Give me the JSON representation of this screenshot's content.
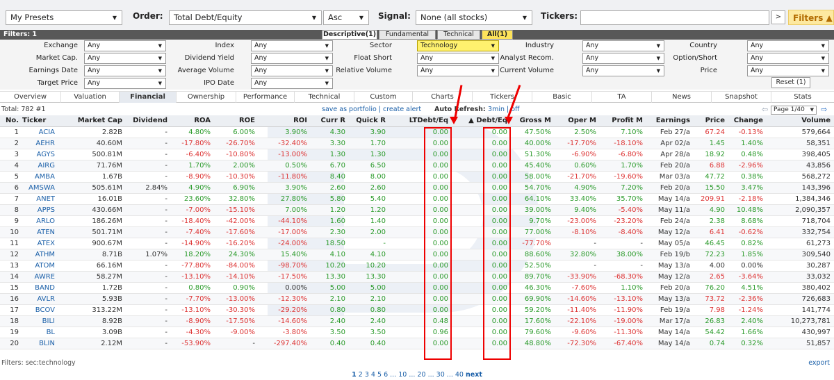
{
  "toolbar": {
    "preset": "My Presets",
    "order_label": "Order:",
    "order_value": "Total Debt/Equity",
    "direction": "Asc",
    "signal_label": "Signal:",
    "signal_value": "None (all stocks)",
    "tickers_label": "Tickers:",
    "tickers_value": "",
    "go_label": ">",
    "filters_label": "Filters ▲"
  },
  "filters_header": "Filters: 1",
  "filter_tabs": [
    "Descriptive(1)",
    "Fundamental",
    "Technical",
    "All(1)"
  ],
  "filter_rows": [
    [
      [
        "Exchange",
        "Any"
      ],
      [
        "Index",
        "Any"
      ],
      [
        "Sector",
        "Technology"
      ],
      [
        "Industry",
        "Any"
      ],
      [
        "Country",
        "Any"
      ]
    ],
    [
      [
        "Market Cap.",
        "Any"
      ],
      [
        "Dividend Yield",
        "Any"
      ],
      [
        "Float Short",
        "Any"
      ],
      [
        "Analyst Recom.",
        "Any"
      ],
      [
        "Option/Short",
        "Any"
      ]
    ],
    [
      [
        "Earnings Date",
        "Any"
      ],
      [
        "Average Volume",
        "Any"
      ],
      [
        "Relative Volume",
        "Any"
      ],
      [
        "Current Volume",
        "Any"
      ],
      [
        "Price",
        "Any"
      ]
    ],
    [
      [
        "Target Price",
        "Any"
      ],
      [
        "IPO Date",
        "Any"
      ]
    ]
  ],
  "reset_label": "Reset (1)",
  "view_tabs": [
    "Overview",
    "Valuation",
    "Financial",
    "Ownership",
    "Performance",
    "Technical",
    "Custom",
    "Charts",
    "Tickers",
    "Basic",
    "TA",
    "News",
    "Snapshot",
    "Stats"
  ],
  "total": "Total: 782 #1",
  "save_links": "save as portfolio | create alert",
  "auto_refresh_label": "Auto Refresh:",
  "auto_refresh_value": "3min | off",
  "page_select": "Page 1/40",
  "columns": [
    "No.",
    "Ticker",
    "Market Cap",
    "Dividend",
    "ROA",
    "ROE",
    "ROI",
    "Curr R",
    "Quick R",
    "LTDebt/Eq",
    "▲ Debt/Eq",
    "Gross M",
    "Oper M",
    "Profit M",
    "Earnings",
    "Price",
    "Change",
    "Volume"
  ],
  "rows": [
    [
      "1",
      "ACIA",
      "2.82B",
      "-",
      "4.80%",
      "6.00%",
      "3.90%",
      "4.30",
      "3.90",
      "0.00",
      "0.00",
      "47.50%",
      "2.50%",
      "7.10%",
      "Feb 27/a",
      "67.24",
      "-0.13%",
      "579,664"
    ],
    [
      "2",
      "AEHR",
      "40.60M",
      "-",
      "-17.80%",
      "-26.70%",
      "-32.40%",
      "3.30",
      "1.70",
      "0.00",
      "0.00",
      "40.00%",
      "-17.70%",
      "-18.10%",
      "Apr 02/a",
      "1.45",
      "1.40%",
      "58,351"
    ],
    [
      "3",
      "AGYS",
      "500.81M",
      "-",
      "-6.40%",
      "-10.80%",
      "-13.00%",
      "1.30",
      "1.30",
      "0.00",
      "0.00",
      "51.30%",
      "-6.90%",
      "-6.80%",
      "Apr 28/a",
      "18.92",
      "0.48%",
      "398,405"
    ],
    [
      "4",
      "AIRG",
      "71.76M",
      "-",
      "1.70%",
      "2.00%",
      "0.50%",
      "6.70",
      "6.50",
      "0.00",
      "0.00",
      "45.40%",
      "0.60%",
      "1.70%",
      "Feb 20/a",
      "6.88",
      "-2.96%",
      "43,856"
    ],
    [
      "5",
      "AMBA",
      "1.67B",
      "-",
      "-8.90%",
      "-10.30%",
      "-11.80%",
      "8.40",
      "8.00",
      "0.00",
      "0.00",
      "58.00%",
      "-21.70%",
      "-19.60%",
      "Mar 03/a",
      "47.72",
      "0.38%",
      "568,272"
    ],
    [
      "6",
      "AMSWA",
      "505.61M",
      "2.84%",
      "4.90%",
      "6.90%",
      "3.90%",
      "2.60",
      "2.60",
      "0.00",
      "0.00",
      "54.70%",
      "4.90%",
      "7.20%",
      "Feb 20/a",
      "15.50",
      "3.47%",
      "143,396"
    ],
    [
      "7",
      "ANET",
      "16.01B",
      "-",
      "23.60%",
      "32.80%",
      "27.80%",
      "5.80",
      "5.40",
      "0.00",
      "0.00",
      "64.10%",
      "33.40%",
      "35.70%",
      "May 14/a",
      "209.91",
      "-2.18%",
      "1,384,346"
    ],
    [
      "8",
      "APPS",
      "430.66M",
      "-",
      "-7.00%",
      "-15.10%",
      "7.00%",
      "1.20",
      "1.20",
      "0.00",
      "0.00",
      "39.00%",
      "9.40%",
      "-5.40%",
      "May 11/a",
      "4.90",
      "10.48%",
      "2,090,357"
    ],
    [
      "9",
      "ARLO",
      "186.26M",
      "-",
      "-18.40%",
      "-42.00%",
      "-44.10%",
      "1.60",
      "1.40",
      "0.00",
      "0.00",
      "9.70%",
      "-23.00%",
      "-23.20%",
      "Feb 24/a",
      "2.38",
      "8.68%",
      "718,704"
    ],
    [
      "10",
      "ATEN",
      "501.71M",
      "-",
      "-7.40%",
      "-17.60%",
      "-17.00%",
      "2.30",
      "2.00",
      "0.00",
      "0.00",
      "77.00%",
      "-8.10%",
      "-8.40%",
      "May 12/a",
      "6.41",
      "-0.62%",
      "332,754"
    ],
    [
      "11",
      "ATEX",
      "900.67M",
      "-",
      "-14.90%",
      "-16.20%",
      "-24.00%",
      "18.50",
      "-",
      "0.00",
      "0.00",
      "-77.70%",
      "-",
      "-",
      "May 05/a",
      "46.45",
      "0.82%",
      "61,273"
    ],
    [
      "12",
      "ATHM",
      "8.71B",
      "1.07%",
      "18.20%",
      "24.30%",
      "15.40%",
      "4.10",
      "4.10",
      "0.00",
      "0.00",
      "88.60%",
      "32.80%",
      "38.00%",
      "Feb 19/b",
      "72.23",
      "1.85%",
      "309,540"
    ],
    [
      "13",
      "ATOM",
      "66.16M",
      "-",
      "-77.80%",
      "-84.00%",
      "-98.70%",
      "10.20",
      "10.20",
      "0.00",
      "0.00",
      "52.50%",
      "-",
      "-",
      "May 13/a",
      "4.00",
      "0.00%",
      "30,287"
    ],
    [
      "14",
      "AWRE",
      "58.27M",
      "-",
      "-13.10%",
      "-14.10%",
      "-17.50%",
      "13.30",
      "13.30",
      "0.00",
      "0.00",
      "89.70%",
      "-33.90%",
      "-68.30%",
      "May 12/a",
      "2.65",
      "-3.64%",
      "33,032"
    ],
    [
      "15",
      "BAND",
      "1.72B",
      "-",
      "0.80%",
      "0.90%",
      "0.00%",
      "5.00",
      "5.00",
      "0.00",
      "0.00",
      "46.30%",
      "-7.60%",
      "1.10%",
      "Feb 20/a",
      "76.20",
      "4.51%",
      "380,402"
    ],
    [
      "16",
      "AVLR",
      "5.93B",
      "-",
      "-7.70%",
      "-13.00%",
      "-12.30%",
      "2.10",
      "2.10",
      "0.00",
      "0.00",
      "69.90%",
      "-14.60%",
      "-13.10%",
      "May 13/a",
      "73.72",
      "-2.36%",
      "726,683"
    ],
    [
      "17",
      "BCOV",
      "313.22M",
      "-",
      "-13.10%",
      "-30.30%",
      "-29.20%",
      "0.80",
      "0.80",
      "0.00",
      "0.00",
      "59.20%",
      "-11.40%",
      "-11.90%",
      "Feb 19/a",
      "7.98",
      "-1.24%",
      "141,774"
    ],
    [
      "18",
      "BILI",
      "8.92B",
      "-",
      "-8.90%",
      "-17.50%",
      "-14.60%",
      "2.40",
      "2.40",
      "0.48",
      "0.00",
      "17.60%",
      "-22.10%",
      "-19.00%",
      "Mar 17/a",
      "26.83",
      "2.40%",
      "10,273,781"
    ],
    [
      "19",
      "BL",
      "3.09B",
      "-",
      "-4.30%",
      "-9.00%",
      "-3.80%",
      "3.50",
      "3.50",
      "0.96",
      "0.00",
      "79.60%",
      "-9.60%",
      "-11.30%",
      "May 14/a",
      "54.42",
      "1.66%",
      "430,997"
    ],
    [
      "20",
      "BLIN",
      "2.12M",
      "-",
      "-53.90%",
      "-",
      "-297.40%",
      "0.40",
      "0.40",
      "0.00",
      "0.00",
      "48.80%",
      "-72.30%",
      "-67.40%",
      "May 14/a",
      "0.74",
      "0.32%",
      "51,857"
    ]
  ],
  "filters_footer": "Filters: sec:technology",
  "export_label": "export",
  "pagination": [
    "1",
    "2",
    "3",
    "4",
    "5",
    "6",
    "...",
    "10",
    "...",
    "20",
    "...",
    "30",
    "...",
    "40",
    "next"
  ],
  "colors": {
    "positive": "#2a9a2a",
    "negative": "#dd3333",
    "link": "#1a5fa8",
    "annotation": "#ee0000",
    "highlight": "#fff16e"
  }
}
